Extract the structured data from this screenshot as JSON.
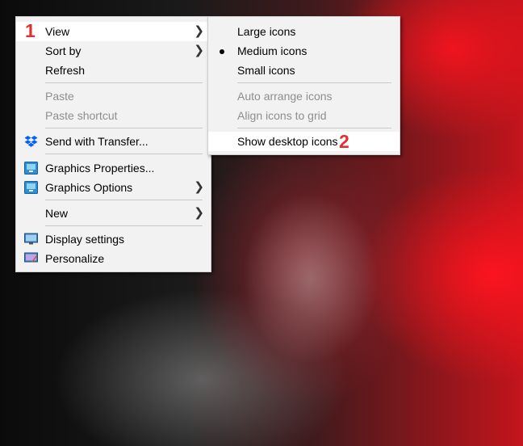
{
  "main_menu": {
    "items": [
      {
        "label": "View",
        "has_submenu": true,
        "highlighted": true
      },
      {
        "label": "Sort by",
        "has_submenu": true
      },
      {
        "label": "Refresh"
      },
      {
        "label": "Paste",
        "disabled": true
      },
      {
        "label": "Paste shortcut",
        "disabled": true
      },
      {
        "label": "Send with Transfer...",
        "icon": "dropbox-icon"
      },
      {
        "label": "Graphics Properties...",
        "icon": "intel-graphics-icon"
      },
      {
        "label": "Graphics Options",
        "icon": "intel-graphics-icon",
        "has_submenu": true
      },
      {
        "label": "New",
        "has_submenu": true
      },
      {
        "label": "Display settings",
        "icon": "display-icon"
      },
      {
        "label": "Personalize",
        "icon": "personalize-icon"
      }
    ]
  },
  "view_submenu": {
    "items": [
      {
        "label": "Large icons"
      },
      {
        "label": "Medium icons",
        "selected": true
      },
      {
        "label": "Small icons"
      },
      {
        "label": "Auto arrange icons",
        "disabled": true
      },
      {
        "label": "Align icons to grid",
        "disabled": true
      },
      {
        "label": "Show desktop icons",
        "highlighted": true
      }
    ]
  },
  "annotations": {
    "step1": "1",
    "step2": "2"
  },
  "colors": {
    "annotation": "#e03030",
    "menu_bg": "#f2f2f2",
    "highlight": "#ffffff",
    "disabled_text": "#8e8e8e"
  }
}
